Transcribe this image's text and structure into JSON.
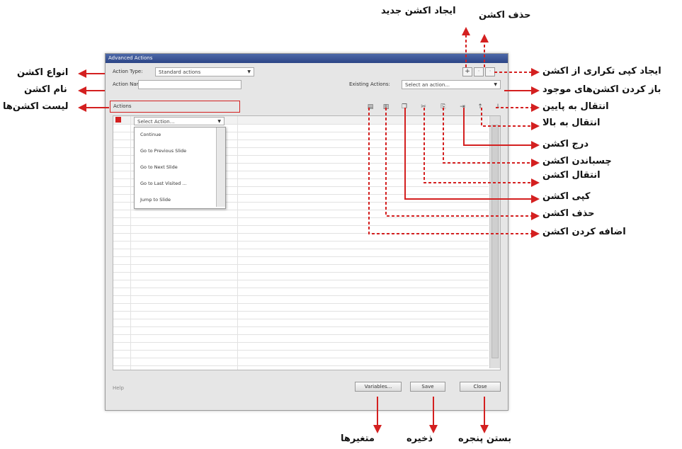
{
  "window": {
    "title": "Advanced Actions",
    "action_type_label": "Action Type:",
    "action_type_value": "Standard actions",
    "action_name_label": "Action Name:",
    "action_name_value": "",
    "existing_actions_label": "Existing Actions:",
    "existing_actions_value": "Select an action...",
    "actions_label": "Actions",
    "select_action_value": "Select Action...",
    "dropdown_items": [
      "Continue",
      "Go to Previous Slide",
      "Go to Next Slide",
      "Go to Last Visited ...",
      "Jump to Slide"
    ],
    "status_text": "Help",
    "buttons": {
      "variables": "Variables...",
      "save": "Save",
      "close": "Close"
    },
    "icons": {
      "create": "+",
      "delete_action": "trash-icon",
      "add": "add-row-icon",
      "remove": "remove-row-icon",
      "copy": "copy-icon",
      "cut": "cut-icon",
      "paste": "paste-icon",
      "insert": "insert-icon",
      "move_up": "up-arrow-icon",
      "move_down": "down-arrow-icon"
    }
  },
  "annotations": {
    "create_new": "ایجاد اکشن جدید",
    "delete_action": "حذف اکشن",
    "duplicate": "ایجاد کپی تکراری از اکشن",
    "open_existing": "باز کردن اکشن‌های موجود",
    "move_down": "انتقال به پایین",
    "move_up": "انتقال به بالا",
    "insert": "درج اکشن",
    "paste": "چسباندن اکشن",
    "cut": "انتقال اکشن",
    "copy": "کپی اکشن",
    "delete": "حذف اکشن",
    "add": "اضافه کردن اکشن",
    "action_types": "انواع اکشن",
    "action_name": "نام اکشن",
    "action_list": "لیست اکشن‌ها",
    "variables": "متغیرها",
    "save": "ذخیره",
    "close_window": "بستن پنجره"
  },
  "colors": {
    "arrow": "#d42020",
    "titlebar": "#2c4586",
    "highlight_box": "#d42020"
  }
}
